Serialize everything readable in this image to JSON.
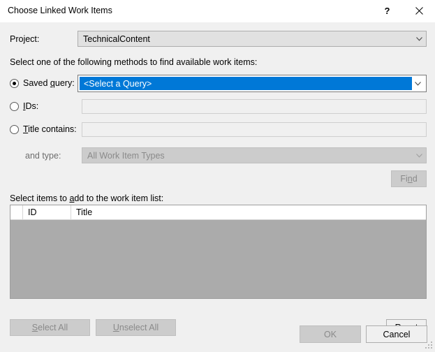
{
  "window": {
    "title": "Choose Linked Work Items",
    "help_icon": "question-mark-icon",
    "close_icon": "close-icon",
    "accent_color": "#0078d7",
    "background_color": "#f0f0f0",
    "titlebar_color": "#ffffff"
  },
  "project": {
    "label": "Project:",
    "value": "TechnicalContent",
    "arrow_icon": "chevron-down-icon"
  },
  "methods": {
    "instruction": "Select one of the following methods to find available work items:",
    "saved_query": {
      "label_pre": "Saved ",
      "label_accel": "q",
      "label_post": "uery:",
      "selected": true,
      "value": "<Select a Query>",
      "arrow_icon": "chevron-down-icon"
    },
    "ids": {
      "label_pre": "",
      "label_accel": "I",
      "label_post": "Ds:",
      "selected": false,
      "value": "",
      "placeholder": ""
    },
    "title_contains": {
      "label_pre": "",
      "label_accel": "T",
      "label_post": "itle contains:",
      "selected": false,
      "value": "",
      "placeholder": ""
    },
    "and_type": {
      "label": "and type:",
      "value": "All Work Item Types",
      "enabled": false,
      "arrow_icon": "chevron-down-icon"
    },
    "find_button": {
      "label_pre": "Fi",
      "label_accel": "n",
      "label_post": "d",
      "enabled": false
    }
  },
  "list": {
    "label_pre": "Select items to ",
    "label_accel": "a",
    "label_post": "dd to the work item list:",
    "columns": [
      "",
      "ID",
      "Title"
    ],
    "rows": [],
    "enabled": false
  },
  "actions": {
    "select_all": {
      "label_pre": "",
      "label_accel": "S",
      "label_post": "elect All",
      "enabled": false
    },
    "unselect_all": {
      "label_pre": "",
      "label_accel": "U",
      "label_post": "nselect All",
      "enabled": false
    },
    "reset": {
      "label_pre": "",
      "label_accel": "R",
      "label_post": "eset",
      "enabled": true
    },
    "ok": {
      "label": "OK",
      "enabled": false
    },
    "cancel": {
      "label": "Cancel",
      "enabled": true
    }
  }
}
